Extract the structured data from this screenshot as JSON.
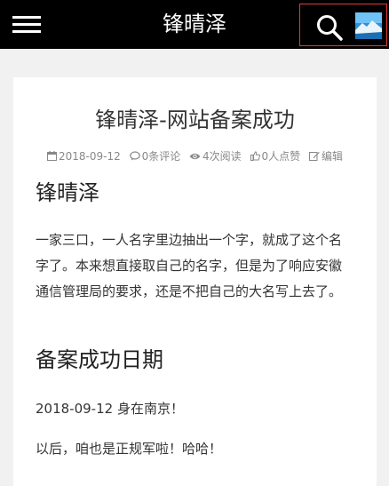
{
  "header": {
    "site_title": "锋晴泽"
  },
  "post": {
    "title": "锋晴泽-网站备案成功",
    "meta": {
      "date": "2018-09-12",
      "comments": "0条评论",
      "views": "4次阅读",
      "likes": "0人点赞",
      "edit": "编辑"
    },
    "sections": [
      {
        "heading": "锋晴泽",
        "paragraphs": [
          "一家三口，一人名字里边抽出一个字，就成了这个名字了。本来想直接取自己的名字，但是为了响应安徽通信管理局的要求，还是不把自己的大名写上去了。"
        ]
      },
      {
        "heading": "备案成功日期",
        "paragraphs": [
          "2018-09-12 身在南京！",
          "以后，咱也是正规军啦！哈哈！"
        ]
      }
    ]
  },
  "colors": {
    "topbar_bg": "#000000",
    "page_bg": "#f1f1f1",
    "highlight_border": "#e53935"
  },
  "icons": [
    "menu-icon",
    "search-icon",
    "avatar",
    "calendar-icon",
    "comment-icon",
    "eye-icon",
    "thumbs-up-icon",
    "edit-icon"
  ]
}
